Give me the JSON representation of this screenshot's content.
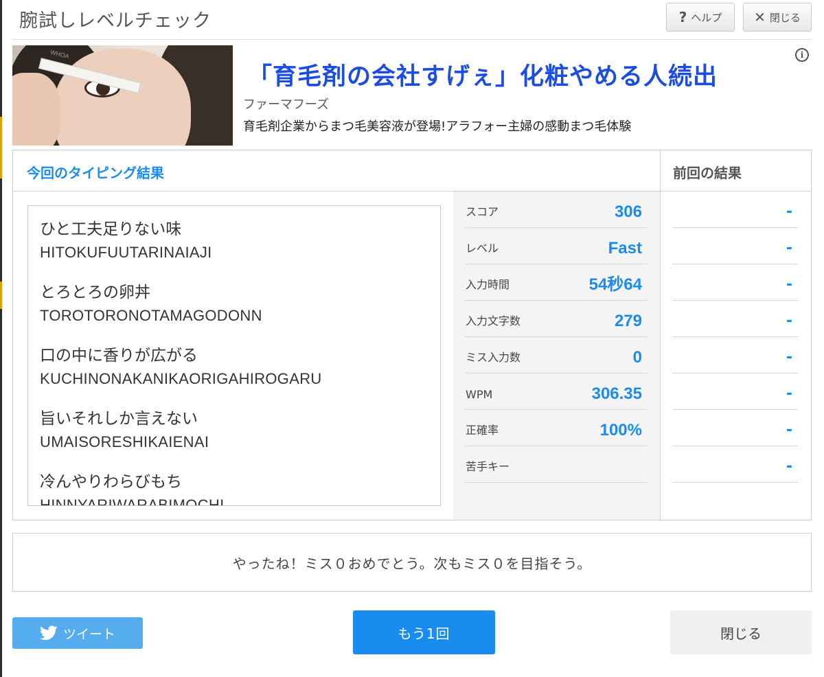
{
  "window": {
    "title": "腕試しレベルチェック",
    "help_label": "ヘルプ",
    "help_icon": "question-icon",
    "close_label": "閉じる",
    "close_icon": "x-icon"
  },
  "ad": {
    "image_text": "WHOA",
    "title": "「育毛剤の会社すげぇ」化粧やめる人続出",
    "sponsor": "ファーマフーズ",
    "description": "育毛剤企業からまつ毛美容液が登場!アラフォー主婦の感動まつ毛体験",
    "info_icon_glyph": "i"
  },
  "results": {
    "current_title": "今回のタイピング結果",
    "previous_title": "前回の結果",
    "words": [
      {
        "jp": "ひと工夫足りない味",
        "romaji": "HITOKUFUUTARINAIAJI"
      },
      {
        "jp": "とろとろの卵丼",
        "romaji": "TOROTORONOTAMAGODONN"
      },
      {
        "jp": "口の中に香りが広がる",
        "romaji": "KUCHINONAKANIKAORIGAHIROGARU"
      },
      {
        "jp": "旨いそれしか言えない",
        "romaji": "UMAISORESHIKAIENAI"
      },
      {
        "jp": "冷んやりわらびもち",
        "romaji": "HINNYARIWARABIMOCHI"
      }
    ],
    "stats": [
      {
        "label": "スコア",
        "value": "306",
        "previous": "-"
      },
      {
        "label": "レベル",
        "value": "Fast",
        "previous": "-"
      },
      {
        "label": "入力時間",
        "value": "54秒64",
        "previous": "-"
      },
      {
        "label": "入力文字数",
        "value": "279",
        "previous": "-"
      },
      {
        "label": "ミス入力数",
        "value": "0",
        "previous": "-"
      },
      {
        "label": "WPM",
        "value": "306.35",
        "previous": "-"
      },
      {
        "label": "正確率",
        "value": "100%",
        "previous": "-"
      },
      {
        "label": "苦手キー",
        "value": "",
        "previous": "-"
      }
    ]
  },
  "message": "やったね！ミス０おめでとう。次もミス０を目指そう。",
  "footer": {
    "tweet_label": "ツイート",
    "retry_label": "もう1回",
    "close_label": "閉じる"
  },
  "colors": {
    "accent": "#1a8cf0",
    "ad_title": "#1a4de0",
    "twitter": "#55acee"
  }
}
